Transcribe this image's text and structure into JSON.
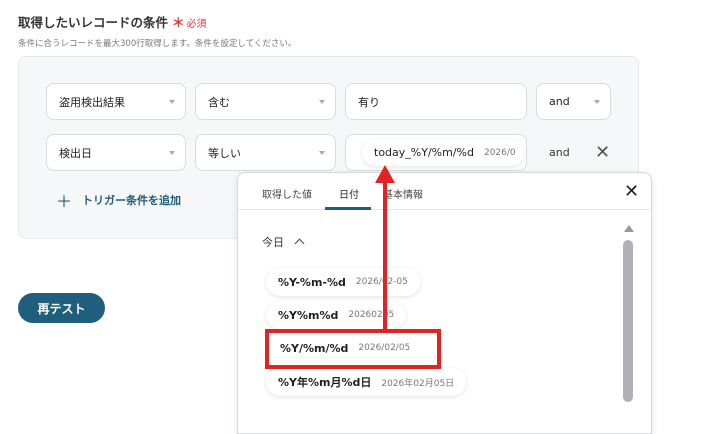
{
  "section": {
    "title": "取得したいレコードの条件",
    "required_mark": "＊",
    "required_label": "必須",
    "subtitle": "条件に合うレコードを最大300行取得します。条件を設定してください。"
  },
  "conditions": [
    {
      "field": "盗用検出結果",
      "operator": "含む",
      "value": "有り",
      "logic": "and"
    },
    {
      "field": "検出日",
      "operator": "等しい",
      "value": "today_%Y/%m/%d",
      "value_preview": "2026/0",
      "logic": "and"
    }
  ],
  "add_trigger_label": "トリガー条件を追加",
  "retest_label": "再テスト",
  "popup": {
    "tabs": [
      {
        "label": "取得した値",
        "active": false
      },
      {
        "label": "日付",
        "active": true
      },
      {
        "label": "基本情報",
        "active": false
      }
    ],
    "section_label": "今日",
    "options": [
      {
        "format": "%Y-%m-%d",
        "preview": "2026/02-05"
      },
      {
        "format": "%Y%m%d",
        "preview": "20260205"
      },
      {
        "format": "%Y/%m/%d",
        "preview": "2026/02/05"
      },
      {
        "format": "%Y年%m月%d日",
        "preview": "2026年02月05日"
      }
    ]
  },
  "colors": {
    "accent": "#1f5f7c",
    "required": "#e0353b",
    "annotation": "#e02424"
  }
}
